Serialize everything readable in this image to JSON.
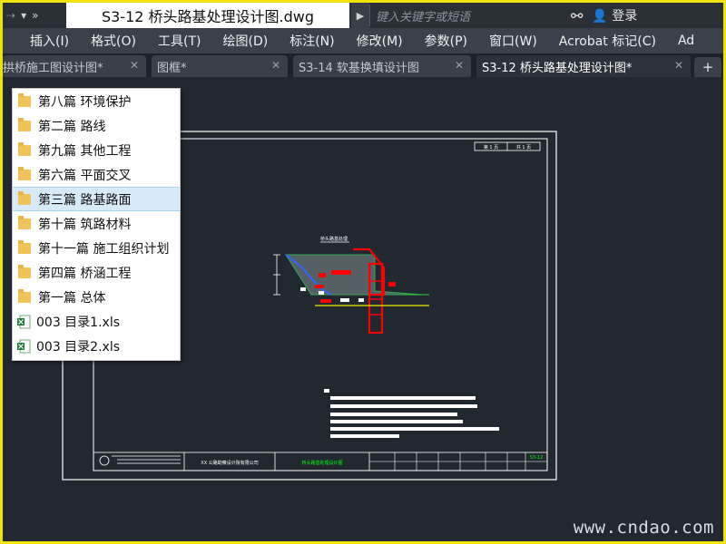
{
  "titlebar": {
    "quick_access_label": "»",
    "document_title": "S3-12 桥头路基处理设计图.dwg",
    "search_placeholder": "键入关键字或短语",
    "login_label": "登录"
  },
  "menu": {
    "items": [
      {
        "label": "插入(I)"
      },
      {
        "label": "格式(O)"
      },
      {
        "label": "工具(T)"
      },
      {
        "label": "绘图(D)"
      },
      {
        "label": "标注(N)"
      },
      {
        "label": "修改(M)"
      },
      {
        "label": "参数(P)"
      },
      {
        "label": "窗口(W)"
      },
      {
        "label": "Acrobat 标记(C)"
      },
      {
        "label": "Ad"
      }
    ]
  },
  "tabs": [
    {
      "label": "拱桥施工图设计图*",
      "close": "✕"
    },
    {
      "label": "图框*",
      "close": "✕"
    },
    {
      "label": "S3-14 软基换填设计图",
      "close": "✕"
    },
    {
      "label": "S3-12 桥头路基处理设计图*",
      "close": "✕"
    }
  ],
  "tab_add_label": "+",
  "dropdown": {
    "items": [
      {
        "label": "第八篇 环境保护",
        "icon": "folder-icon"
      },
      {
        "label": "第二篇 路线",
        "icon": "folder-icon"
      },
      {
        "label": "第九篇 其他工程",
        "icon": "folder-icon"
      },
      {
        "label": "第六篇 平面交叉",
        "icon": "folder-icon"
      },
      {
        "label": "第三篇 路基路面",
        "icon": "folder-icon",
        "selected": true
      },
      {
        "label": "第十篇 筑路材料",
        "icon": "folder-icon"
      },
      {
        "label": "第十一篇 施工组织计划",
        "icon": "folder-icon"
      },
      {
        "label": "第四篇 桥涵工程",
        "icon": "folder-icon"
      },
      {
        "label": "第一篇 总体",
        "icon": "folder-icon"
      },
      {
        "label": "003 目录1.xls",
        "icon": "excel-file-icon"
      },
      {
        "label": "003 目录2.xls",
        "icon": "excel-file-icon"
      }
    ]
  },
  "drawing": {
    "sheet_no": "第 1 页",
    "sheet_total": "共 1 页",
    "section_title": "桥头路基处理",
    "company_name": "XX 公路勘察设计院有限公司",
    "drawing_title": "桥头路基处理设计图",
    "drawing_code": "S3-12"
  },
  "colors": {
    "canvas_bg": "#212830",
    "outer_frame": "#ffffff",
    "highlight_red": "#ff0000",
    "drawing_green": "#00ff00",
    "drawing_blue": "#3366ff",
    "yellow_line": "#cccc00"
  },
  "watermark": "www.cndao.com"
}
